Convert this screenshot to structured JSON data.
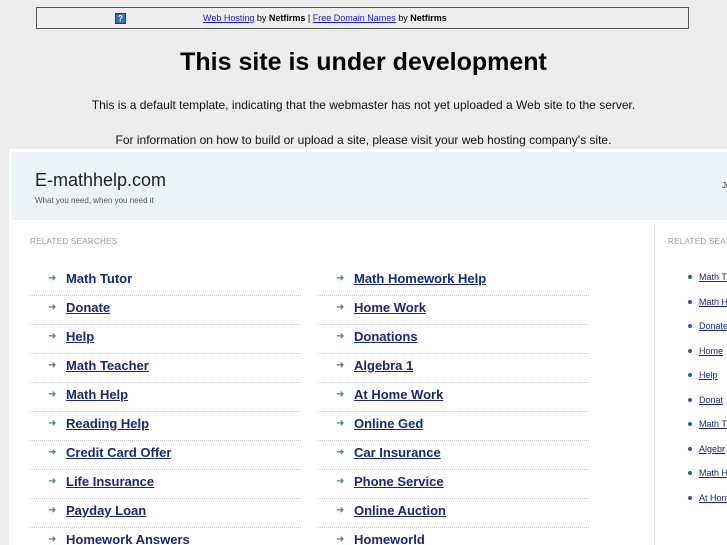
{
  "topbar": {
    "help_icon": "question-icon",
    "link1": "Web Hosting",
    "by1": " by ",
    "brand1": "Netfirms",
    "sep": " | ",
    "link2": "Free Domain Names",
    "by2": " by ",
    "brand2": "Netfirms"
  },
  "notice": {
    "title": "This site is under development",
    "line1": "This is a default template, indicating that the webmaster has not yet uploaded a Web site to the server.",
    "line2": "For information on how to build or upload a site, please visit your web hosting company's site."
  },
  "site": {
    "name": "E-mathhelp.com",
    "tagline": "What you need, when you need it",
    "header_right": "Ju"
  },
  "related": {
    "label": "RELATED SEARCHES",
    "col1": [
      "Math Tutor",
      "Donate",
      "Help",
      "Math Teacher",
      "Math Help",
      "Reading Help",
      "Credit Card Offer",
      "Life Insurance",
      "Payday Loan",
      "Homework Answers"
    ],
    "col2": [
      "Math Homework Help",
      "Home Work",
      "Donations",
      "Algebra 1",
      "At Home Work",
      "Online Ged",
      "Car Insurance",
      "Phone Service",
      "Online Auction",
      "Homeworld"
    ]
  },
  "sidebar": {
    "label": "RELATED SEA",
    "items": [
      "Math T",
      "Math H",
      "Donate",
      "Home",
      "Help",
      "Donat",
      "Math T",
      "Algebr",
      "Math H",
      "At Hom"
    ]
  }
}
